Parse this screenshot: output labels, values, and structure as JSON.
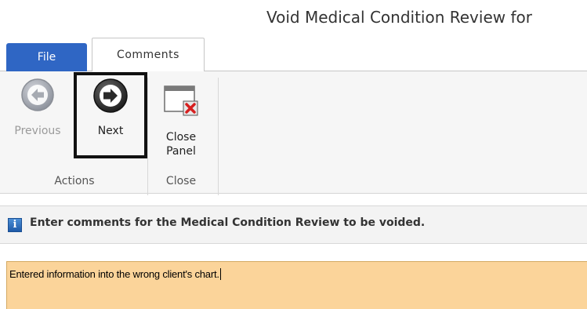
{
  "window": {
    "title": "Void Medical Condition Review for"
  },
  "tabs": [
    {
      "label": "File"
    },
    {
      "label": "Comments"
    }
  ],
  "ribbon": {
    "groups": [
      {
        "label": "Actions",
        "buttons": [
          {
            "label": "Previous",
            "icon": "previous-arrow-icon",
            "enabled": false
          },
          {
            "label": "Next",
            "icon": "next-arrow-icon",
            "enabled": true
          }
        ]
      },
      {
        "label": "Close",
        "buttons": [
          {
            "label_line1": "Close",
            "label_line2": "Panel",
            "icon": "close-panel-icon"
          }
        ]
      }
    ]
  },
  "info_bar": {
    "icon": "info-icon",
    "message": "Enter comments for the Medical Condition Review to be voided."
  },
  "comment_field": {
    "value": "Entered information into the wrong client's chart."
  },
  "colors": {
    "file_tab": "#2f66c4",
    "comment_bg": "#fbd49a",
    "highlight_border": "#111111"
  }
}
